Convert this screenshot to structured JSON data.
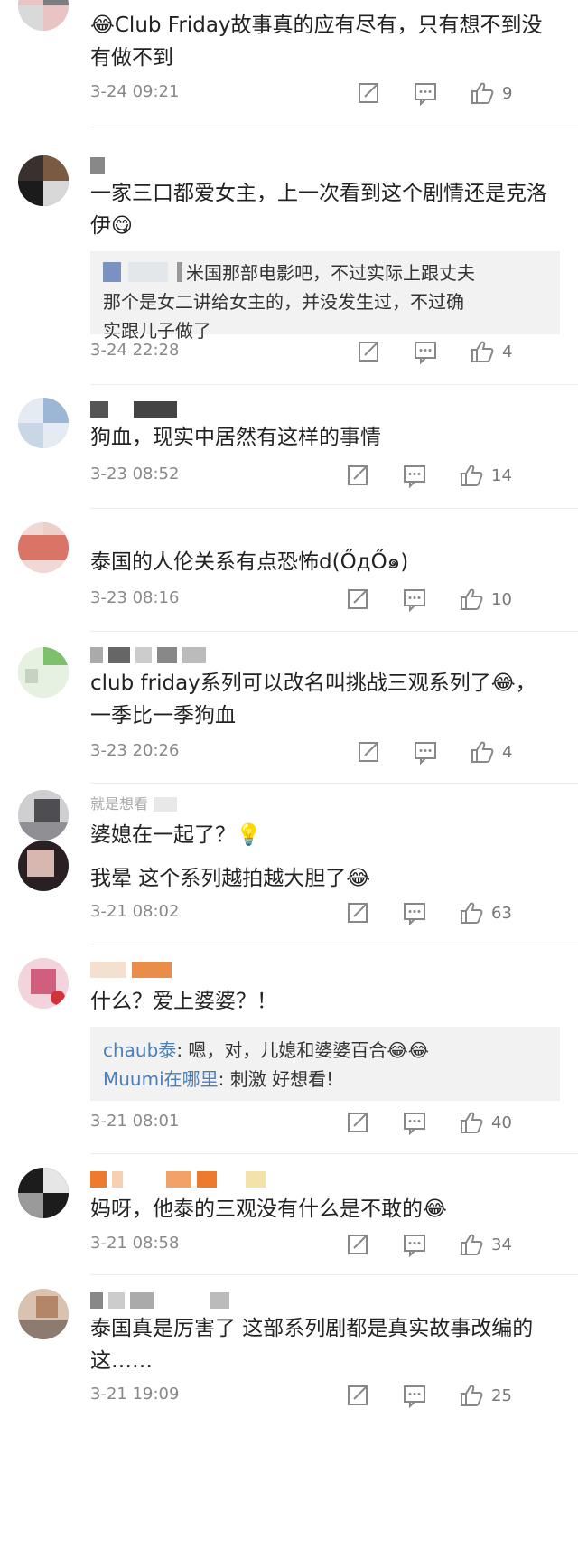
{
  "comments": [
    {
      "text": "😂Club Friday故事真的应有尽有，只有想不到没有做不到",
      "date": "3-24 09:21",
      "likes": "9"
    },
    {
      "text": "一家三口都爱女主，上一次看到这个剧情还是克洛伊😋",
      "reply_lines": [
        "米国那部电影吧，不过实际上跟丈夫",
        "那个是女二讲给女主的，并没发生过，不过确",
        "实跟儿子做了"
      ],
      "date": "3-24 22:28",
      "likes": "4"
    },
    {
      "text": "狗血，现实中居然有这样的事情",
      "date": "3-23 08:52",
      "likes": "14"
    },
    {
      "text": "泰国的人伦关系有点恐怖d(ŐдŐ๑)",
      "date": "3-23 08:16",
      "likes": "10"
    },
    {
      "text": "club friday系列可以改名叫挑战三观系列了😂，一季比一季狗血",
      "date": "3-23 20:26",
      "likes": "4"
    },
    {
      "name_fragment": "就是想看",
      "text": "婆媳在一起了？💡",
      "text2": "我晕 这个系列越拍越大胆了😂",
      "date": "3-21 08:02",
      "likes": "63"
    },
    {
      "text": "什么？爱上婆婆？！",
      "replies": [
        {
          "name": "chaub泰",
          "content": ": 嗯，对，儿媳和婆婆百合😂😂"
        },
        {
          "name": "Muumi在哪里",
          "content": ": 刺激 好想看!"
        }
      ],
      "date": "3-21 08:01",
      "likes": "40"
    },
    {
      "text": "妈呀，他泰的三观没有什么是不敢的😂",
      "date": "3-21 08:58",
      "likes": "34"
    },
    {
      "text": "泰国真是厉害了 这部系列剧都是真实故事改编的 这……",
      "date": "3-21 19:09",
      "likes": "25"
    }
  ],
  "icons": {
    "share": "share-icon",
    "comment": "comment-icon",
    "like": "thumbs-up-icon"
  },
  "colors": {
    "reply_name": "#4a7fb8",
    "meta_text": "#888888",
    "reply_bg": "#f2f2f2"
  }
}
